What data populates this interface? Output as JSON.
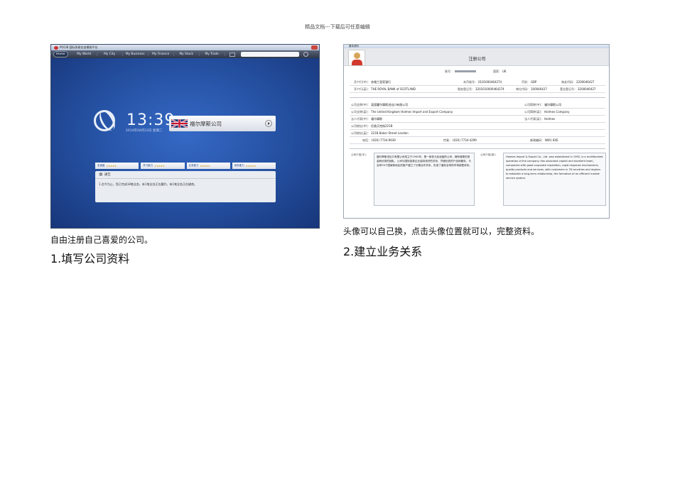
{
  "header_note": "精品文档---下载后可任意编辑",
  "left_shot": {
    "window_title": "POCIB 国际贸易实务模拟平台",
    "nav": [
      "Home",
      "My World",
      "My City",
      "My Business",
      "My Finance",
      "My Stock",
      "My Trade"
    ],
    "clock_time": "13:39",
    "clock_date": "2014年04月22日 星期二",
    "company_name": "福尔摩斯公司",
    "stats": [
      {
        "label": "忠诚度",
        "stars": "★★★★★"
      },
      {
        "label": "学习能力",
        "stars": "★★★★★"
      },
      {
        "label": "业务能力",
        "stars": "★★★★★"
      },
      {
        "label": "商务能力",
        "stars": "★★★★★"
      }
    ],
    "notice_title": "通告",
    "notice_text": "1.迄今为止，您已完成18笔业务，有1笔业务正在履约，有1笔业务正在磋商。"
  },
  "right_shot": {
    "window_title": "基本资料",
    "form_title": "注册公司",
    "account_label": "账号：",
    "country_label": "国家：",
    "country_value": "UK",
    "rows": {
      "bank_cn_label": "开户行(中)：",
      "bank_cn_value": "苏格兰皇家银行",
      "account_no_label": "本币账号：",
      "account_no_value": "0101000464274",
      "currency_label": "币别：",
      "currency_value": "GBP",
      "customs_code_label": "海关代码：",
      "customs_code_value": "2200046427",
      "bank_en_label": "开户行(英)：",
      "bank_en_value": "THE ROYAL BANK of SCOTLAND",
      "tax_reg_label": "税务登记号：",
      "tax_reg_value": "3201010000464274",
      "unit_code_label": "单位代码：",
      "unit_code_value": "100046427",
      "reg_no_label": "营业登记号：",
      "reg_no_value": "3200046427",
      "name_cn_label": "公司全称(中)：",
      "name_cn_value": "英国霍尔摩斯进出口有限公司",
      "short_cn_label": "公司简称(中)：",
      "short_cn_value": "福尔摩斯公司",
      "name_en_label": "公司全称(英)：",
      "name_en_value": "The United Kingdom Holmes Import and Export Company",
      "short_en_label": "公司简称(英)：",
      "short_en_value": "Holmes Company",
      "rep_cn_label": "法人代表(中)：",
      "rep_cn_value": "福尔摩斯",
      "rep_en_label": "法人代表(英)：",
      "rep_en_value": "Holmes",
      "addr_cn_label": "公司地址(中)：",
      "addr_cn_value": "伦敦贝克街221B",
      "addr_en_label": "公司地址(英)：",
      "addr_en_value": "221B Baker Street London",
      "phone_label": "电话：",
      "phone_value": "(020) 7734-9639",
      "fax_label": "传真：",
      "fax_value": "(020) 7734-4299",
      "zip_label": "邮政编码：",
      "zip_value": "NW1 6XE"
    },
    "intro_cn_label": "公司介绍(中)：",
    "intro_cn_text": "福尔摩斯进出口有限公司成立于1992年，是一家多元化经营的公司，拥有雄厚的资金和优秀的团队，公司与国际各类企业保持良好的关系，凭借优质的产品和服务，与全球76个国家和地区的客户建立了长期合作关系，形成了遍布全球的市场销售体系。",
    "intro_en_label": "公司介绍(英)：",
    "intro_en_text": "Holmes Import & Export Co., Ltd. was established in 1992, is a multifaceted operation of the company. Has abundant capital and excellent team, companies with good corporate reputation, rapid response mechanisms, quality products and services, with customers in 76 countries and regions to establish a long-term relationship, the formation of an efficient market service system."
  },
  "captions": {
    "left_note": "自由注册自己喜爱的公司。",
    "left_heading": "1.填写公司资料",
    "right_note": "头像可以自己换，点击头像位置就可以，完整资料。",
    "right_heading": "2.建立业务关系"
  }
}
